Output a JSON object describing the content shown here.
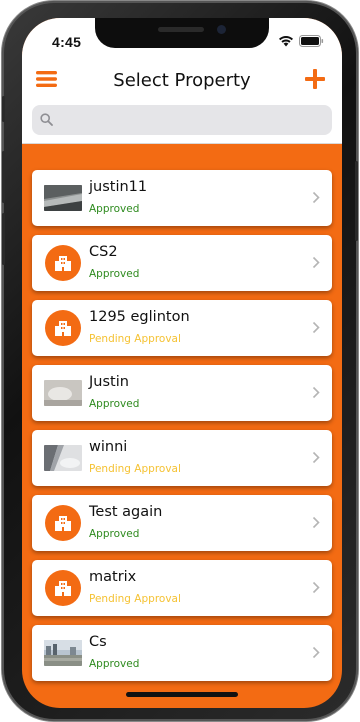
{
  "status_bar": {
    "time": "4:45",
    "icons": [
      "wifi-icon",
      "battery-icon"
    ]
  },
  "nav": {
    "title": "Select Property",
    "menu_icon": "hamburger-menu-icon",
    "add_icon": "plus-icon"
  },
  "search": {
    "placeholder": "",
    "value": ""
  },
  "colors": {
    "accent": "#f36b13",
    "approved": "#2e8b1f",
    "pending": "#f5c233"
  },
  "properties": [
    {
      "name": "justin11",
      "status": "Approved",
      "image": "photo"
    },
    {
      "name": "CS2",
      "status": "Approved",
      "image": "building-icon"
    },
    {
      "name": "1295 eglinton",
      "status": "Pending Approval",
      "image": "building-icon"
    },
    {
      "name": "Justin",
      "status": "Approved",
      "image": "photo"
    },
    {
      "name": "winni",
      "status": "Pending Approval",
      "image": "photo"
    },
    {
      "name": "Test again",
      "status": "Approved",
      "image": "building-icon"
    },
    {
      "name": "matrix",
      "status": "Pending Approval",
      "image": "building-icon"
    },
    {
      "name": "Cs",
      "status": "Approved",
      "image": "photo"
    }
  ]
}
